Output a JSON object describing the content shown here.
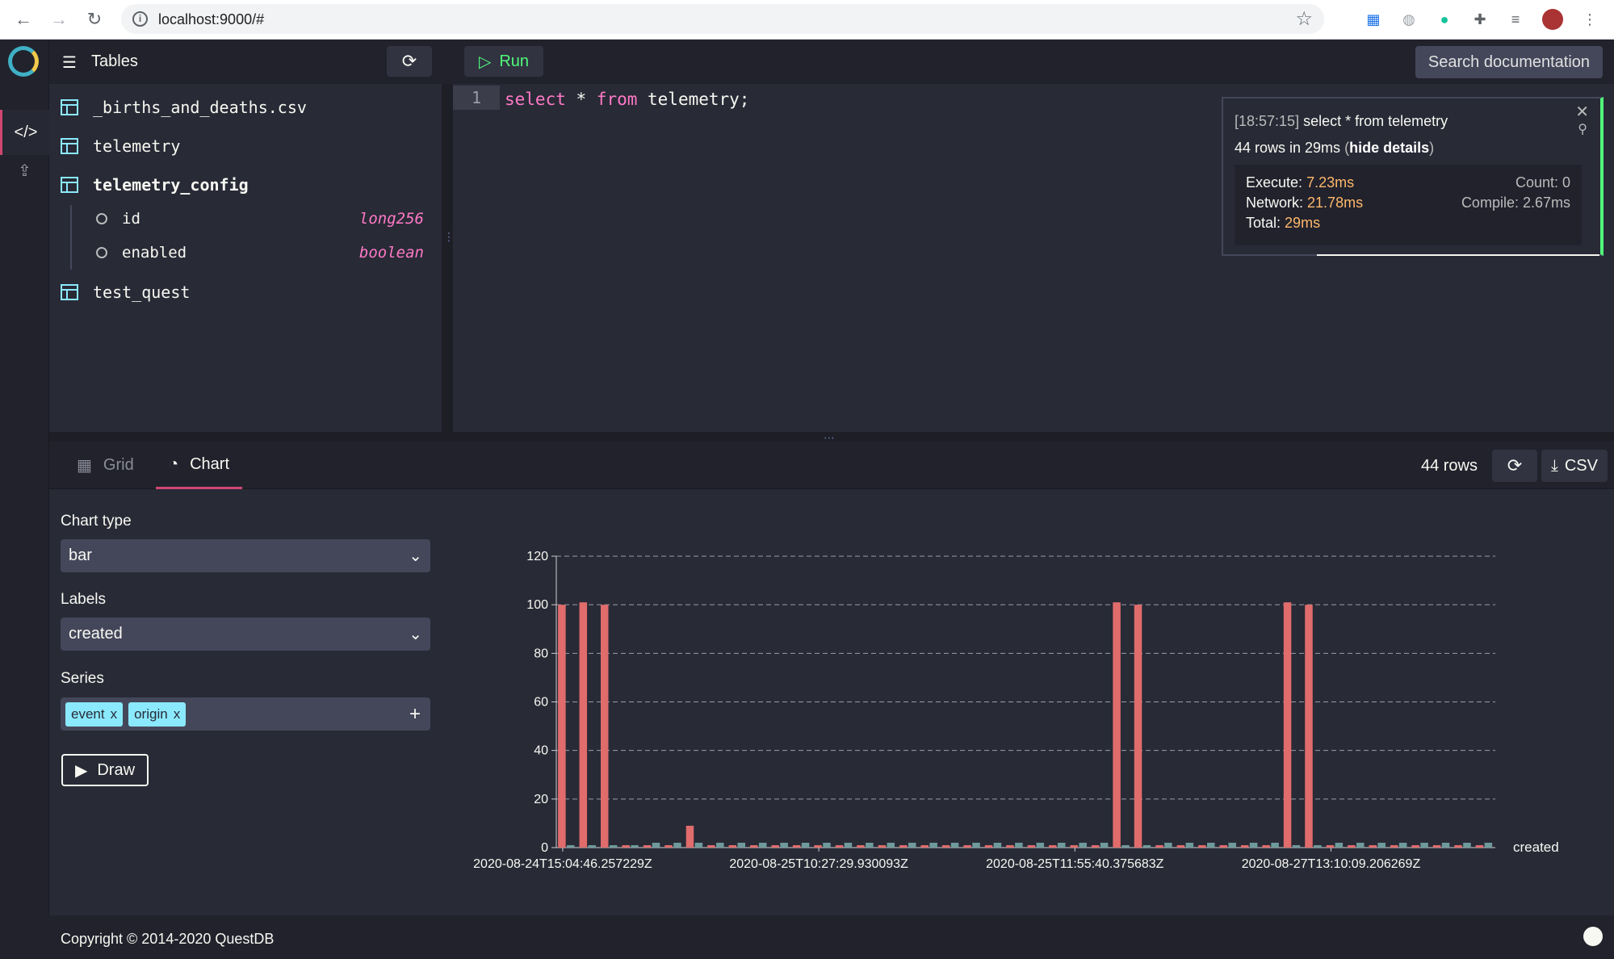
{
  "browser": {
    "url": "localhost:9000/#"
  },
  "tables_panel": {
    "title": "Tables",
    "tables": [
      {
        "name": "_births_and_deaths.csv"
      },
      {
        "name": "telemetry"
      },
      {
        "name": "telemetry_config",
        "columns": [
          {
            "name": "id",
            "type": "long256"
          },
          {
            "name": "enabled",
            "type": "boolean"
          }
        ]
      },
      {
        "name": "test_quest"
      }
    ]
  },
  "toolbar": {
    "run_label": "Run",
    "search_docs_label": "Search documentation"
  },
  "editor": {
    "line_number": "1",
    "tokens": {
      "select": "select",
      "star": " * ",
      "from": "from",
      "rest": " telemetry;"
    }
  },
  "notification": {
    "timestamp": "[18:57:15]",
    "query": "select * from telemetry",
    "summary": "44 rows in 29ms",
    "toggle_open": "(",
    "toggle_label": "hide details",
    "toggle_close": ")",
    "execute_label": "Execute:",
    "execute_value": "7.23ms",
    "network_label": "Network:",
    "network_value": "21.78ms",
    "total_label": "Total:",
    "total_value": "29ms",
    "count": "Count: 0",
    "compile": "Compile: 2.67ms"
  },
  "results": {
    "tabs": {
      "grid": "Grid",
      "chart": "Chart"
    },
    "row_count": "44 rows",
    "csv_label": "CSV"
  },
  "chart_config": {
    "chart_type_label": "Chart type",
    "chart_type_value": "bar",
    "labels_label": "Labels",
    "labels_value": "created",
    "series_label": "Series",
    "series_chips": [
      {
        "name": "event",
        "remove": "x"
      },
      {
        "name": "origin",
        "remove": "x"
      }
    ],
    "draw_label": "Draw"
  },
  "chart_data": {
    "type": "bar",
    "xlabel": "created",
    "ylabel": "",
    "ylim": [
      0,
      120
    ],
    "yticks": [
      0,
      20,
      40,
      60,
      80,
      100,
      120
    ],
    "x_tick_labels": [
      {
        "index": 0,
        "label": "2020-08-24T15:04:46.257229Z"
      },
      {
        "index": 12,
        "label": "2020-08-25T10:27:29.930093Z"
      },
      {
        "index": 24,
        "label": "2020-08-25T11:55:40.375683Z"
      },
      {
        "index": 36,
        "label": "2020-08-27T13:10:09.206269Z"
      }
    ],
    "grid": "horizontal dashed",
    "series": [
      {
        "name": "event",
        "color": "#e06c6c",
        "values": [
          100,
          101,
          100,
          1,
          1,
          1,
          9,
          1,
          1,
          1,
          1,
          1,
          1,
          1,
          1,
          1,
          1,
          1,
          1,
          1,
          1,
          1,
          1,
          1,
          1,
          1,
          101,
          100,
          1,
          1,
          1,
          1,
          1,
          1,
          101,
          100,
          1,
          1,
          1,
          1,
          1,
          1,
          1,
          1
        ]
      },
      {
        "name": "origin",
        "color": "#6f9a9c",
        "values": [
          1,
          1,
          1,
          1,
          2,
          2,
          2,
          2,
          2,
          2,
          2,
          2,
          2,
          2,
          2,
          2,
          2,
          2,
          2,
          2,
          2,
          2,
          2,
          2,
          2,
          2,
          1,
          1,
          2,
          2,
          2,
          2,
          2,
          2,
          1,
          1,
          2,
          2,
          2,
          2,
          2,
          2,
          2,
          2
        ]
      }
    ]
  },
  "footer": {
    "copyright": "Copyright © 2014-2020 QuestDB"
  },
  "colors": {
    "accent": "#d14671",
    "keyword": "#ff79c6",
    "run": "#50fa7b",
    "timing": "#ffb86c",
    "chip": "#8be9fd"
  }
}
